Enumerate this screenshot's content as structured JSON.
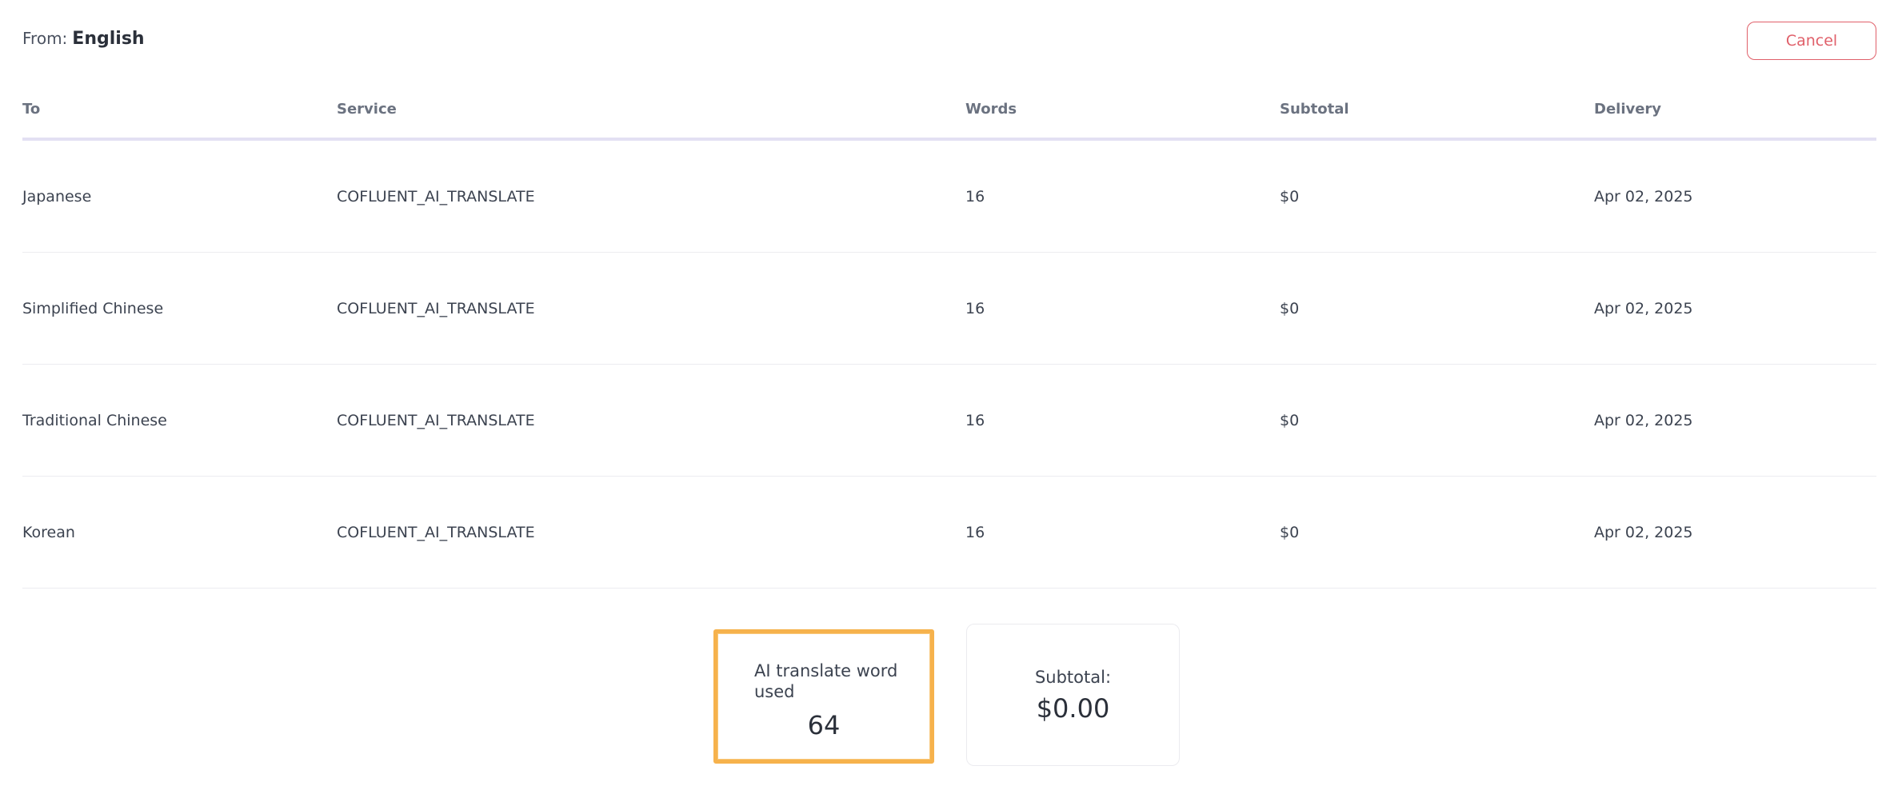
{
  "header": {
    "from_label": "From:",
    "from_language": "English",
    "cancel_label": "Cancel"
  },
  "table": {
    "columns": [
      "To",
      "Service",
      "Words",
      "Subtotal",
      "Delivery"
    ],
    "rows": [
      {
        "to": "Japanese",
        "service": "COFLUENT_AI_TRANSLATE",
        "words": "16",
        "subtotal": "$0",
        "delivery": "Apr 02, 2025"
      },
      {
        "to": "Simplified Chinese",
        "service": "COFLUENT_AI_TRANSLATE",
        "words": "16",
        "subtotal": "$0",
        "delivery": "Apr 02, 2025"
      },
      {
        "to": "Traditional Chinese",
        "service": "COFLUENT_AI_TRANSLATE",
        "words": "16",
        "subtotal": "$0",
        "delivery": "Apr 02, 2025"
      },
      {
        "to": "Korean",
        "service": "COFLUENT_AI_TRANSLATE",
        "words": "16",
        "subtotal": "$0",
        "delivery": "Apr 02, 2025"
      }
    ]
  },
  "summary": {
    "ai_words_label": "AI translate word used",
    "ai_words_value": "64",
    "subtotal_label": "Subtotal:",
    "subtotal_value": "$0.00"
  },
  "colors": {
    "cancel": "#e0606a",
    "highlight": "#f6b24c",
    "header_rule": "#e3e0f3"
  }
}
